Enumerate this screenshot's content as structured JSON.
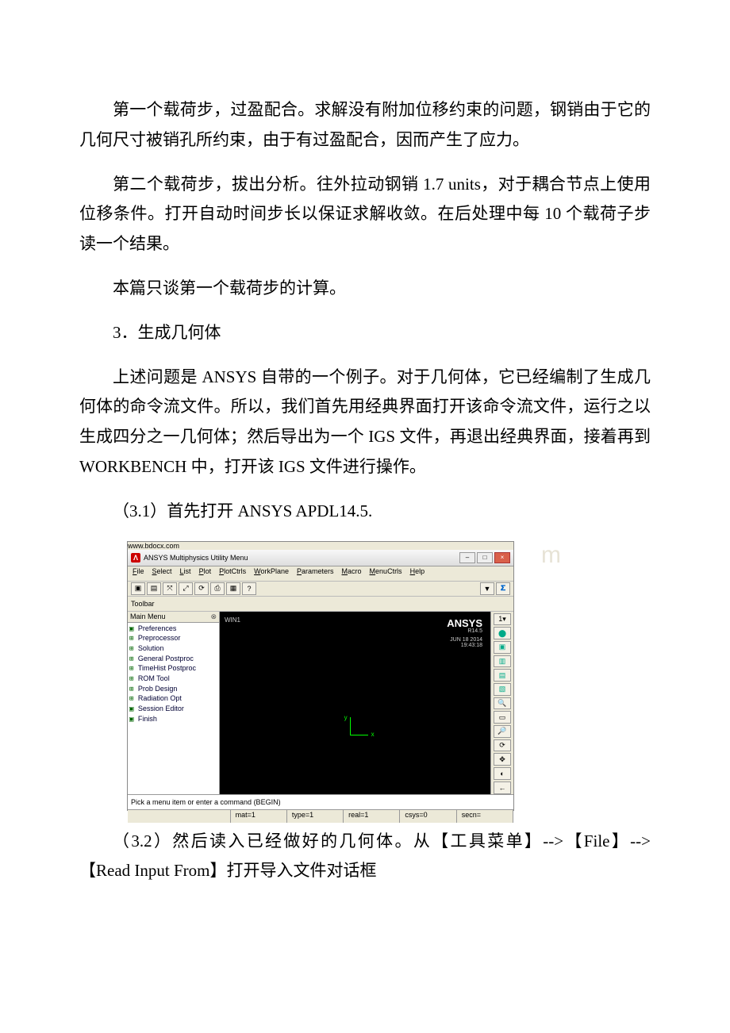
{
  "paragraphs": {
    "p1": "第一个载荷步，过盈配合。求解没有附加位移约束的问题，钢销由于它的几何尺寸被销孔所约束，由于有过盈配合，因而产生了应力。",
    "p2": "第二个载荷步，拔出分析。往外拉动钢销 1.7 units，对于耦合节点上使用位移条件。打开自动时间步长以保证求解收敛。在后处理中每 10 个载荷子步读一个结果。",
    "p3": "本篇只谈第一个载荷步的计算。",
    "h3": "3．生成几何体",
    "p4": "上述问题是 ANSYS 自带的一个例子。对于几何体，它已经编制了生成几何体的命令流文件。所以，我们首先用经典界面打开该命令流文件，运行之以生成四分之一几何体；然后导出为一个 IGS 文件，再退出经典界面，接着再到 WORKBENCH 中，打开该 IGS 文件进行操作。",
    "p5": "（3.1）首先打开 ANSYS APDL14.5.",
    "p6": "（3.2）然后读入已经做好的几何体。从【工具菜单】-->【File】-->【Read Input From】打开导入文件对话框"
  },
  "screenshot": {
    "titlebar": {
      "icon_letter": "Λ",
      "title": "ANSYS Multiphysics Utility Menu"
    },
    "menubar": [
      "File",
      "Select",
      "List",
      "Plot",
      "PlotCtrls",
      "WorkPlane",
      "Parameters",
      "Macro",
      "MenuCtrls",
      "Help"
    ],
    "toolbar2_label": "Toolbar",
    "mainmenu": {
      "title": "Main Menu",
      "items": [
        "Preferences",
        "Preprocessor",
        "Solution",
        "General Postproc",
        "TimeHist Postproc",
        "ROM Tool",
        "Prob Design",
        "Radiation Opt",
        "Session Editor",
        "Finish"
      ]
    },
    "viewport": {
      "brand": "ANSYS",
      "brand_sub": "R14.5",
      "date1": "JUN 18 2014",
      "date2": "19:43:18",
      "axis_x": "x",
      "axis_y": "y",
      "window_label": "WIN1"
    },
    "cmdbar": "Pick a menu item or enter a command (BEGIN)",
    "statusbar": [
      "",
      "mat=1",
      "type=1",
      "real=1",
      "csys=0",
      "secn="
    ],
    "watermark": "www.bdocx.com"
  }
}
